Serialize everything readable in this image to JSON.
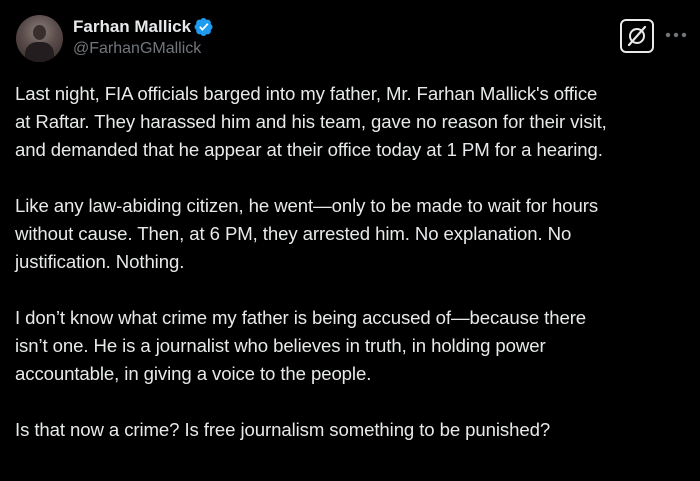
{
  "author": {
    "display_name": "Farhan Mallick",
    "handle": "@FarhanGMallick",
    "verified": true
  },
  "colors": {
    "background": "#000000",
    "text": "#e7e9ea",
    "secondary_text": "#71767b",
    "verified_badge": "#1d9bf0"
  },
  "icons": {
    "verified": "verified-badge-icon",
    "grok": "grok-icon",
    "more": "more-options-icon"
  },
  "tweet": {
    "paragraphs": [
      "Last night, FIA officials barged into my father, Mr. Farhan Mallick's office\nat Raftar. They harassed him and his team, gave no reason for their visit,\nand demanded that he appear at their office today at 1 PM for a hearing.",
      "Like any law-abiding citizen, he went—only to be made to wait for hours\nwithout cause. Then, at 6 PM, they arrested him. No explanation. No\njustification. Nothing.",
      "I don’t know what crime my father is being accused of—because there\nisn’t one. He is a journalist who believes in truth, in holding power\naccountable, in giving a voice to the people.",
      "Is that now a crime? Is free journalism something to be punished?"
    ]
  }
}
